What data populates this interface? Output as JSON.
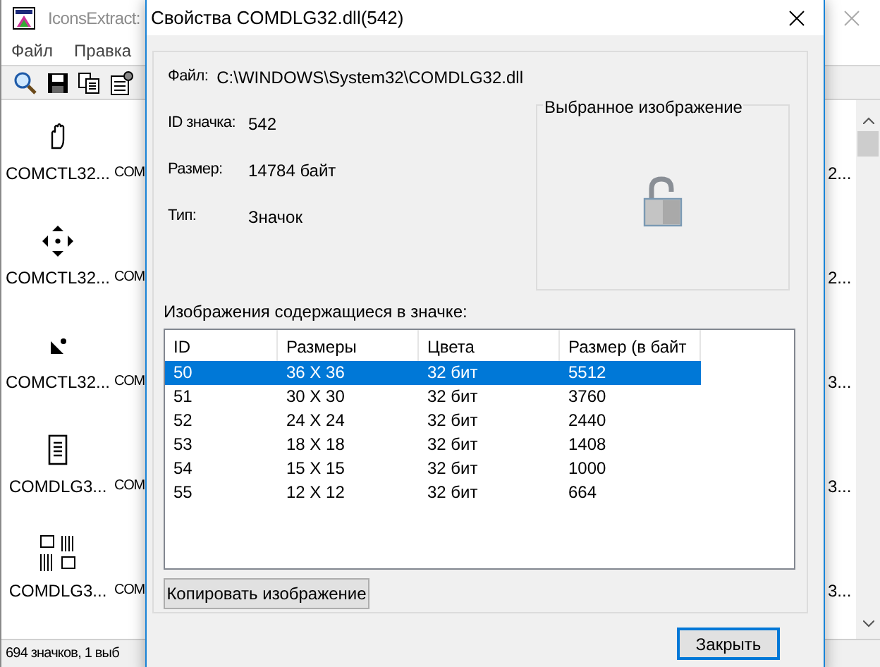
{
  "background_window": {
    "title": "IconsExtract:",
    "menu": [
      "Файл",
      "Правка"
    ],
    "icons": [
      {
        "kind": "hand",
        "label": "COMCTL32...",
        "next_label": "COM",
        "right_label": "2..."
      },
      {
        "kind": "move",
        "label": "COMCTL32...",
        "next_label": "COM",
        "right_label": "2..."
      },
      {
        "kind": "corner",
        "label": "COMCTL32...",
        "next_label": "COM",
        "right_label": "3..."
      },
      {
        "kind": "document",
        "label": "COMDLG3...",
        "next_label": "COM",
        "right_label": "3..."
      },
      {
        "kind": "pattern",
        "label": "COMDLG3...",
        "next_label": "COM",
        "right_label": "3..."
      }
    ],
    "status_bar": "694 значков, 1 выб"
  },
  "dialog": {
    "title": "Свойства COMDLG32.dll(542)",
    "fields": [
      {
        "label": "Файл:",
        "value": "C:\\WINDOWS\\System32\\COMDLG32.dll"
      },
      {
        "label": "ID значка:",
        "value": "542"
      },
      {
        "label": "Размер:",
        "value": "14784 байт"
      },
      {
        "label": "Тип:",
        "value": "Значок"
      }
    ],
    "preview_title": "Выбранное изображение",
    "list_title": "Изображения содержащиеся в значке:",
    "table": {
      "columns": [
        "ID",
        "Размеры",
        "Цвета",
        "Размер (в байт"
      ],
      "rows": [
        {
          "cells": [
            "50",
            "36 X 36",
            "32 бит",
            "5512"
          ],
          "selected": true
        },
        {
          "cells": [
            "51",
            "30 X 30",
            "32 бит",
            "3760"
          ],
          "selected": false
        },
        {
          "cells": [
            "52",
            "24 X 24",
            "32 бит",
            "2440"
          ],
          "selected": false
        },
        {
          "cells": [
            "53",
            "18 X 18",
            "32 бит",
            "1408"
          ],
          "selected": false
        },
        {
          "cells": [
            "54",
            "15 X 15",
            "32 бит",
            "1000"
          ],
          "selected": false
        },
        {
          "cells": [
            "55",
            "12 X 12",
            "32 бит",
            "664"
          ],
          "selected": false
        }
      ]
    },
    "copy_button": "Копировать изображение",
    "close_button": "Закрыть"
  }
}
